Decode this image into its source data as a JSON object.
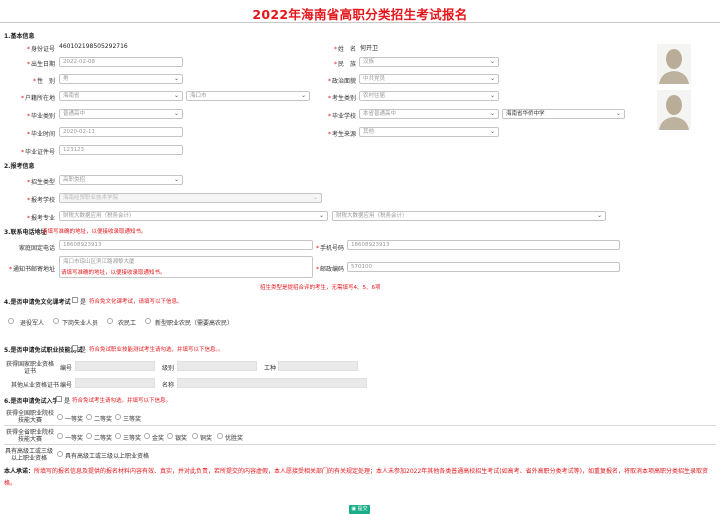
{
  "title": "2022年海南省高职分类招生考试报名",
  "sections": {
    "basic": "1.基本信息",
    "apply": "2.报考信息",
    "contact": "3.联系电话地址",
    "contact_note": "请填写准确的地址，以便接收录取通知书。",
    "s4": "4.是否申请免文化课考试",
    "s4_note": "符合免文化课考试，请填写以下信息。",
    "s5": "5.是否申请免试职业技能测试",
    "s5_note": "符合免试职业技能测试考生请勾选，并填写以下信息。。",
    "s6": "6.是否申请免试入学",
    "s6_note": "符合免试考生请勾选，并填写以下信息。"
  },
  "basic": {
    "id_label": "身份证号",
    "id_value": "460102198505292716",
    "name_label": "姓　名",
    "name_value": "何开卫",
    "birth_label": "出生日期",
    "birth_value": "2022-02-08",
    "ethnic_label": "民　族",
    "ethnic_value": "汉族",
    "gender_label": "性　别",
    "gender_value": "男",
    "political_label": "政治面貌",
    "political_value": "中共党员",
    "hukou_label": "户籍所在地",
    "hukou_prov": "海南省",
    "hukou_city": "海口市",
    "category_label": "考生类别",
    "category_value": "农村往届",
    "gradtype_label": "毕业类别",
    "gradtype_value": "普通高中",
    "school_label": "毕业学校",
    "school_value1": "本省普通高中",
    "school_value2": "海南省华侨中学",
    "gradtime_label": "毕业时间",
    "gradtime_value": "2020-02-11",
    "source_label": "考生来源",
    "source_value": "其他",
    "cert_label": "毕业证件号",
    "cert_value": "123123"
  },
  "apply": {
    "type_label": "招生类型",
    "type_value": "高职类招",
    "school_label": "报考学校",
    "school_value": "海南经贸职业技术学院",
    "major_label": "报考专业",
    "major1": "财税大数据应用（税务会计）",
    "major2": "财税大数据应用（税务会计）"
  },
  "contact": {
    "home_label": "家庭固定电话",
    "home_value": "18608923913",
    "phone_label": "手机号码",
    "phone_value": "18608923913",
    "addr_label": "通知书邮寄地址",
    "addr_value": "海口市琼山区滨江路湘黎大厦",
    "addr_hint": "请填写准确的地址，以便接收录取通知书。",
    "zip_label": "邮政编码",
    "zip_value": "570100",
    "red_note": "招生类型是提招合评的考生，无需填写4、5、6项"
  },
  "s4": {
    "yes": "是",
    "options": [
      "退役军人",
      "下岗失业人员",
      "农民工",
      "新型职业农民（需要高农民）"
    ]
  },
  "s5": {
    "yes": "是",
    "cert_label": "获得国家职业资格证书",
    "num_label": "编号",
    "level_label": "级别",
    "type_label": "工种",
    "other_label": "其他从业资格证书",
    "other_num": "编号",
    "other_name": "名称"
  },
  "s6": {
    "yes": "是",
    "row1_label": "获得全国职业院校技能大赛",
    "row1_opts": [
      "一等奖",
      "二等奖",
      "三等奖"
    ],
    "row2_label": "获得全省职业院校技能大赛",
    "row2_opts": [
      "一等奖",
      "二等奖",
      "三等奖",
      "金奖",
      "银奖",
      "铜奖",
      "优胜奖"
    ],
    "row3_label": "具有高级工或三级以上职业资格",
    "row3_opt": "具有高级工或三级以上职业资格"
  },
  "pledge": {
    "lead": "本人承诺：",
    "text": "所填写的报名信息及提供的报名材料内容有效、真实，并对此负责，若所提交的内容虚假，本人愿接受相关部门的有关规定处理；本人未参加2022年其他各类普通高校招生考试(如高考、省外高职分类考试等)，如重复报名，将取消本项高职分类招生录取资格。"
  },
  "submit": "提交"
}
